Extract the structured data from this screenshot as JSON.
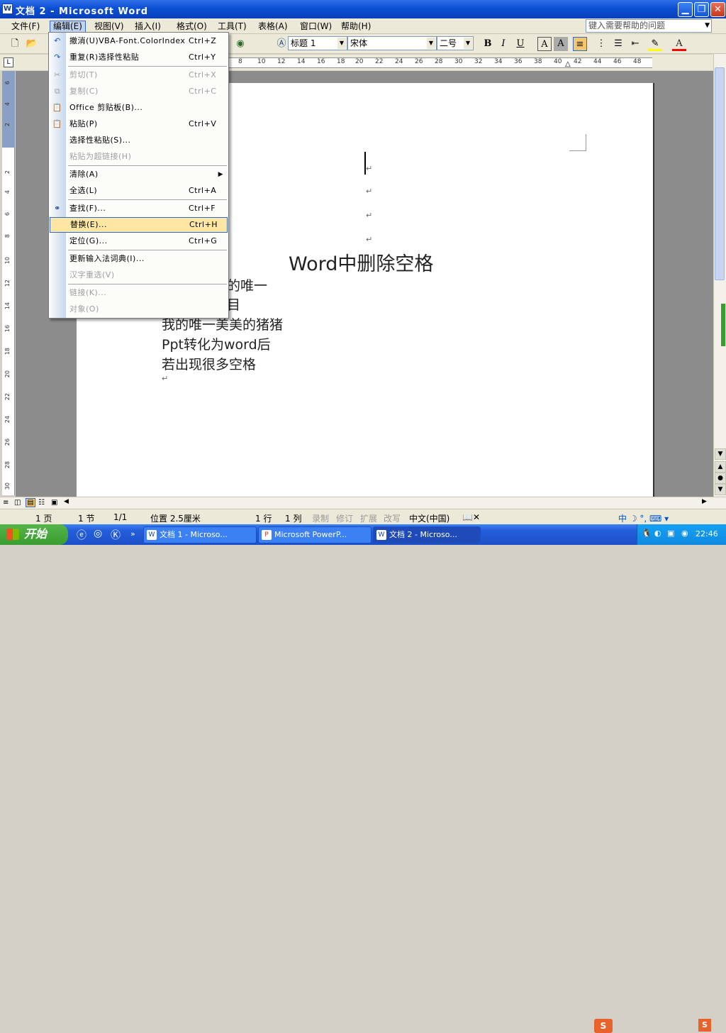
{
  "window": {
    "title": "文档 2 - Microsoft Word",
    "app_icon": "W"
  },
  "menubar": {
    "items": [
      "文件(F)",
      "编辑(E)",
      "视图(V)",
      "插入(I)",
      "格式(O)",
      "工具(T)",
      "表格(A)",
      "窗口(W)",
      "帮助(H)"
    ],
    "help_placeholder": "键入需要帮助的问题"
  },
  "toolbar": {
    "style": "标题 1",
    "font": "宋体",
    "size": "二号",
    "bold": "B",
    "italic": "I",
    "underline": "U",
    "highlight_color": "#ffff00",
    "font_color": "#ff0000"
  },
  "ruler": {
    "numbers": [
      "8",
      "10",
      "12",
      "14",
      "16",
      "18",
      "20",
      "22",
      "24",
      "26",
      "28",
      "30",
      "32",
      "34",
      "36",
      "38",
      "40",
      "42",
      "44",
      "46",
      "48"
    ]
  },
  "vruler": {
    "numbers": [
      "6",
      "4",
      "2",
      "2",
      "4",
      "6",
      "8",
      "10",
      "12",
      "14",
      "16",
      "18",
      "20",
      "22",
      "24",
      "26",
      "28",
      "30"
    ]
  },
  "edit_menu": {
    "items": [
      {
        "label": "撤消(U)VBA-Font.ColorIndex",
        "shortcut": "Ctrl+Z",
        "enabled": true,
        "icon": "undo-icon"
      },
      {
        "label": "重复(R)选择性粘贴",
        "shortcut": "Ctrl+Y",
        "enabled": true,
        "icon": "redo-icon"
      },
      {
        "label": "剪切(T)",
        "shortcut": "Ctrl+X",
        "enabled": false,
        "icon": "cut-icon"
      },
      {
        "label": "复制(C)",
        "shortcut": "Ctrl+C",
        "enabled": false,
        "icon": "copy-icon"
      },
      {
        "label": "Office 剪贴板(B)...",
        "shortcut": "",
        "enabled": true,
        "icon": "clipboard-icon"
      },
      {
        "label": "粘贴(P)",
        "shortcut": "Ctrl+V",
        "enabled": true,
        "icon": "paste-icon"
      },
      {
        "label": "选择性粘贴(S)...",
        "shortcut": "",
        "enabled": true
      },
      {
        "label": "粘贴为超链接(H)",
        "shortcut": "",
        "enabled": false
      },
      {
        "label": "清除(A)",
        "shortcut": "",
        "enabled": true,
        "submenu": true
      },
      {
        "label": "全选(L)",
        "shortcut": "Ctrl+A",
        "enabled": true
      },
      {
        "label": "查找(F)...",
        "shortcut": "Ctrl+F",
        "enabled": true,
        "icon": "binoculars-icon"
      },
      {
        "label": "替换(E)...",
        "shortcut": "Ctrl+H",
        "enabled": true,
        "highlighted": true
      },
      {
        "label": "定位(G)...",
        "shortcut": "Ctrl+G",
        "enabled": true
      },
      {
        "label": "更新输入法词典(I)...",
        "shortcut": "",
        "enabled": true
      },
      {
        "label": "汉字重选(V)",
        "shortcut": "",
        "enabled": false
      },
      {
        "label": "链接(K)...",
        "shortcut": "",
        "enabled": false
      },
      {
        "label": "对象(O)",
        "shortcut": "",
        "enabled": false
      }
    ]
  },
  "document": {
    "title_line": "Word中删除空格",
    "lines": [
      "的唯一",
      "目",
      "我的唯一美美的猪猪",
      "Ppt转化为word后",
      "若出现很多空格"
    ]
  },
  "statusbar": {
    "page": "1 页",
    "section": "1 节",
    "pages": "1/1",
    "position": "位置 2.5厘米",
    "line": "1 行",
    "column": "1 列",
    "rec": "录制",
    "trk": "修订",
    "ext": "扩展",
    "ovr": "改写",
    "language": "中文(中国)"
  },
  "taskbar": {
    "start": "开始",
    "tasks": [
      {
        "label": "文档 1 - Microso...",
        "active": false
      },
      {
        "label": "Microsoft PowerP...",
        "active": false
      },
      {
        "label": "文档 2 - Microso...",
        "active": true
      }
    ],
    "clock": "22:46"
  }
}
